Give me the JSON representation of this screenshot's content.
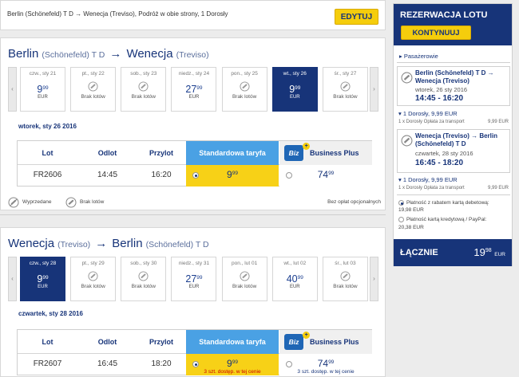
{
  "topbar": {
    "summary": "Berlin (Schönefeld) T D → Wenecja (Treviso), Podróż w obie strony, 1 Dorosły",
    "edit_label": "EDYTUJ"
  },
  "outbound": {
    "from_city": "Berlin",
    "from_sub": "(Schönefeld) T D",
    "to_city": "Wenecja",
    "to_sub": "(Treviso)",
    "days": [
      {
        "label": "czw., sty 21",
        "price_int": "9",
        "price_dec": "99",
        "currency": "EUR",
        "selected": false,
        "no_flight": false
      },
      {
        "label": "pt., sty 22",
        "no_flight": true,
        "nf_label": "Brak lotów"
      },
      {
        "label": "sob., sty 23",
        "no_flight": true,
        "nf_label": "Brak lotów"
      },
      {
        "label": "niedz., sty 24",
        "price_int": "27",
        "price_dec": "99",
        "currency": "EUR",
        "selected": false,
        "no_flight": false
      },
      {
        "label": "pon., sty 25",
        "no_flight": true,
        "nf_label": "Brak lotów"
      },
      {
        "label": "wt., sty 26",
        "price_int": "9",
        "price_dec": "99",
        "currency": "EUR",
        "selected": true,
        "no_flight": false
      },
      {
        "label": "śr., sty 27",
        "no_flight": true,
        "nf_label": "Brak lotów"
      }
    ],
    "day_title": "wtorek, sty 26 2016",
    "table": {
      "h_flight": "Lot",
      "h_depart": "Odlot",
      "h_arrive": "Przylot",
      "h_standard": "Standardowa taryfa",
      "h_biz_badge": "Biz",
      "h_business": "Business Plus",
      "flight": "FR2606",
      "depart": "14:45",
      "arrive": "16:20",
      "std_int": "9",
      "std_dec": "99",
      "std_note": "",
      "biz_int": "74",
      "biz_dec": "99",
      "biz_note": ""
    },
    "legend": {
      "sold_out": "Wyprzedane",
      "no_flights": "Brak lotów",
      "no_fees": "Bez opłat opcjonalnych"
    }
  },
  "inbound": {
    "from_city": "Wenecja",
    "from_sub": "(Treviso)",
    "to_city": "Berlin",
    "to_sub": "(Schönefeld) T D",
    "days": [
      {
        "label": "czw., sty 28",
        "price_int": "9",
        "price_dec": "99",
        "currency": "EUR",
        "selected": true,
        "no_flight": false
      },
      {
        "label": "pt., sty 29",
        "no_flight": true,
        "nf_label": "Brak lotów"
      },
      {
        "label": "sob., sty 30",
        "no_flight": true,
        "nf_label": "Brak lotów"
      },
      {
        "label": "niedz., sty 31",
        "price_int": "27",
        "price_dec": "99",
        "currency": "EUR",
        "selected": false,
        "no_flight": false
      },
      {
        "label": "pon., lut 01",
        "no_flight": true,
        "nf_label": "Brak lotów"
      },
      {
        "label": "wt., lut 02",
        "price_int": "40",
        "price_dec": "99",
        "currency": "EUR",
        "selected": false,
        "no_flight": false
      },
      {
        "label": "śr., lut 03",
        "no_flight": true,
        "nf_label": "Brak lotów"
      }
    ],
    "day_title": "czwartek, sty 28 2016",
    "table": {
      "h_flight": "Lot",
      "h_depart": "Odlot",
      "h_arrive": "Przylot",
      "h_standard": "Standardowa taryfa",
      "h_biz_badge": "Biz",
      "h_business": "Business Plus",
      "flight": "FR2607",
      "depart": "16:45",
      "arrive": "18:20",
      "std_int": "9",
      "std_dec": "99",
      "std_note": "3 szt. dostęp. w tej cenie",
      "biz_int": "74",
      "biz_dec": "99",
      "biz_note": "3 szt. dostęp. w tej cenie"
    }
  },
  "sidebar": {
    "title": "REZERWACJA LOTU",
    "continue_label": "KONTYNUUJ",
    "passengers_label": "▸ Pasażerowie",
    "out_route": "Berlin (Schönefeld) T D → Wenecja (Treviso)",
    "out_date": "wtorek, 26 sty 2016",
    "out_time": "14:45 - 16:20",
    "out_pax": "▾ 1 Dorosły, 9,99 EUR",
    "out_fee_label": "1 x Dorosły Opłata za transport",
    "out_fee_val": "9,99 EUR",
    "in_route": "Wenecja (Treviso) → Berlin (Schönefeld) T D",
    "in_date": "czwartek, 28 sty 2016",
    "in_time": "16:45 - 18:20",
    "in_pax": "▾ 1 Dorosły, 9,99 EUR",
    "in_fee_label": "1 x Dorosły Opłata za transport",
    "in_fee_val": "9,99 EUR",
    "pay_debit": "Płatność z rabatem kartą debetową:",
    "pay_debit_val": "19,98 EUR",
    "pay_credit": "Płatność kartą kredytową / PayPal:",
    "pay_credit_val": "20,38 EUR",
    "total_label": "ŁĄCZNIE",
    "total_int": "19",
    "total_dec": "98",
    "total_cur": "EUR"
  },
  "colors": {
    "brand_blue": "#173479",
    "accent_yellow": "#f5cd0c",
    "standard_header": "#4aa1e4"
  }
}
